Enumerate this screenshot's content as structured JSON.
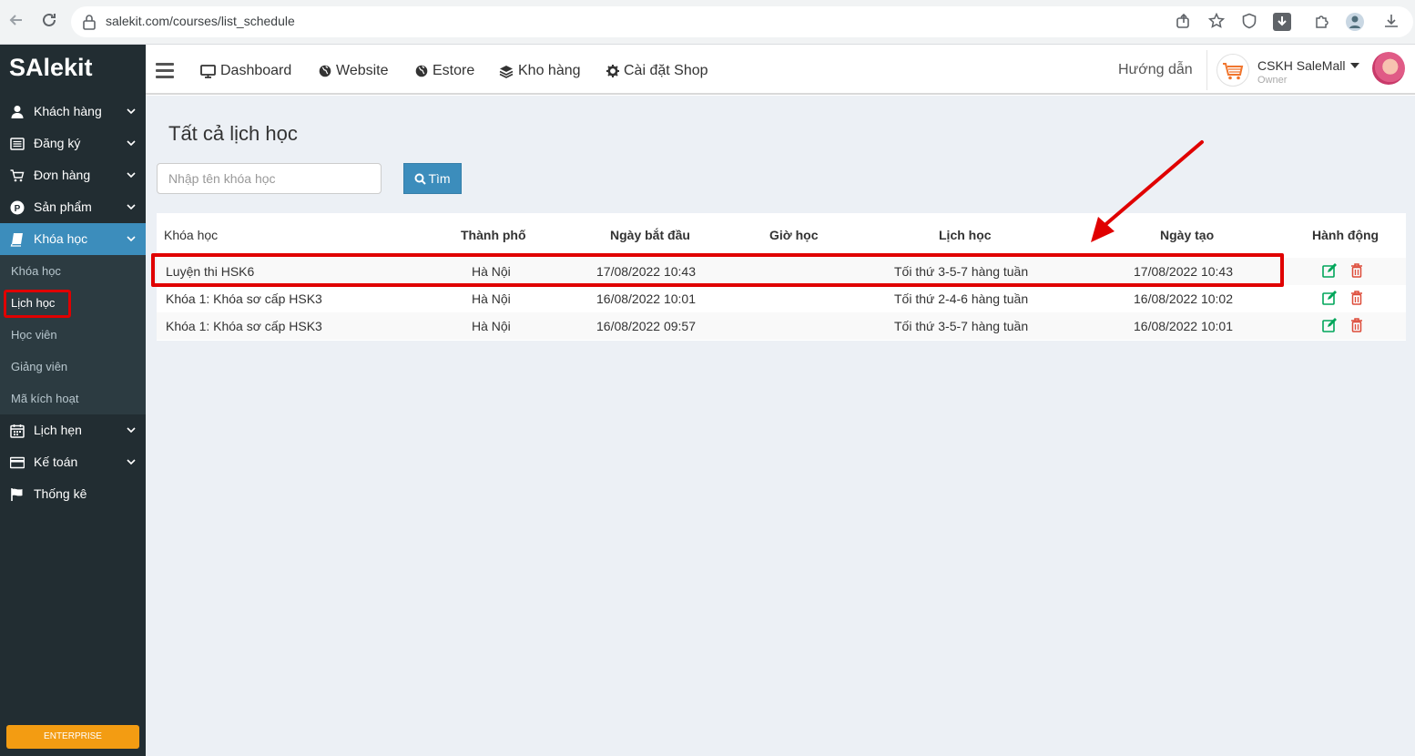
{
  "browser": {
    "url": "salekit.com/courses/list_schedule"
  },
  "sidebar": {
    "logo": "SAlekit",
    "items": [
      {
        "label": "Khách hàng",
        "icon": "user-icon"
      },
      {
        "label": "Đăng ký",
        "icon": "list-icon"
      },
      {
        "label": "Đơn hàng",
        "icon": "cart-icon"
      },
      {
        "label": "Sản phẩm",
        "icon": "product-icon"
      },
      {
        "label": "Khóa học",
        "icon": "book-icon"
      }
    ],
    "sub_items": [
      {
        "label": "Khóa học"
      },
      {
        "label": "Lịch học"
      },
      {
        "label": "Học viên"
      },
      {
        "label": "Giảng viên"
      },
      {
        "label": "Mã kích hoạt"
      }
    ],
    "items_after": [
      {
        "label": "Lịch hẹn",
        "icon": "calendar-icon"
      },
      {
        "label": "Kế toán",
        "icon": "credit-card-icon"
      },
      {
        "label": "Thống kê",
        "icon": "flag-icon"
      }
    ],
    "enterprise_label": "ENTERPRISE"
  },
  "topbar": {
    "nav": [
      {
        "label": "Dashboard",
        "icon": "monitor-icon"
      },
      {
        "label": "Website",
        "icon": "globe-icon"
      },
      {
        "label": "Estore",
        "icon": "globe-icon"
      },
      {
        "label": "Kho hàng",
        "icon": "layers-icon"
      },
      {
        "label": "Cài đặt Shop",
        "icon": "gear-icon"
      }
    ],
    "guide": "Hướng dẫn",
    "user_name": "CSKH SaleMall",
    "user_role": "Owner"
  },
  "main": {
    "title": "Tất cả lịch học",
    "search": {
      "placeholder": "Nhập tên khóa học",
      "button": "Tìm"
    },
    "columns": [
      "Khóa học",
      "Thành phố",
      "Ngày bắt đầu",
      "Giờ học",
      "Lịch học",
      "Ngày tạo",
      "Hành động"
    ],
    "rows": [
      {
        "course": "Luyện thi HSK6",
        "city": "Hà Nội",
        "start": "17/08/2022 10:43",
        "time": "",
        "schedule": "Tối thứ 3-5-7 hàng tuần",
        "created": "17/08/2022 10:43"
      },
      {
        "course": "Khóa 1: Khóa sơ cấp HSK3",
        "city": "Hà Nội",
        "start": "16/08/2022 10:01",
        "time": "",
        "schedule": "Tối thứ 2-4-6 hàng tuần",
        "created": "16/08/2022 10:02"
      },
      {
        "course": "Khóa 1: Khóa sơ cấp HSK3",
        "city": "Hà Nội",
        "start": "16/08/2022 09:57",
        "time": "",
        "schedule": "Tối thứ 3-5-7 hàng tuần",
        "created": "16/08/2022 10:01"
      }
    ]
  },
  "colors": {
    "sidebar_bg": "#222d32",
    "accent": "#3c8dbc",
    "highlight": "#e00000",
    "edit": "#00a65a",
    "delete": "#dd4b39"
  }
}
